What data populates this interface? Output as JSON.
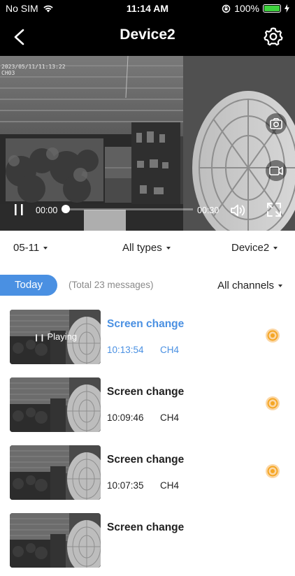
{
  "status": {
    "carrier": "No SIM",
    "time": "11:14 AM",
    "battery": "100%"
  },
  "nav": {
    "title": "Device2"
  },
  "video": {
    "osd_date": "2023/05/11/11:13:22",
    "osd_channel": "CH03",
    "current_time": "00:00",
    "duration": "00:30",
    "progress": 0
  },
  "filters": {
    "date": "05-11",
    "type": "All types",
    "device": "Device2"
  },
  "list_header": {
    "today": "Today",
    "total": "(Total 23 messages)",
    "channels": "All channels"
  },
  "events": [
    {
      "title": "Screen change",
      "time": "10:13:54",
      "channel": "CH4",
      "playing": true,
      "playing_label": "Playing"
    },
    {
      "title": "Screen change",
      "time": "10:09:46",
      "channel": "CH4",
      "playing": false
    },
    {
      "title": "Screen change",
      "time": "10:07:35",
      "channel": "CH4",
      "playing": false
    },
    {
      "title": "Screen change",
      "time": "",
      "channel": "",
      "playing": false
    }
  ],
  "colors": {
    "accent": "#4a90e2",
    "badge": "#f5a623",
    "battery": "#3ed33e"
  }
}
